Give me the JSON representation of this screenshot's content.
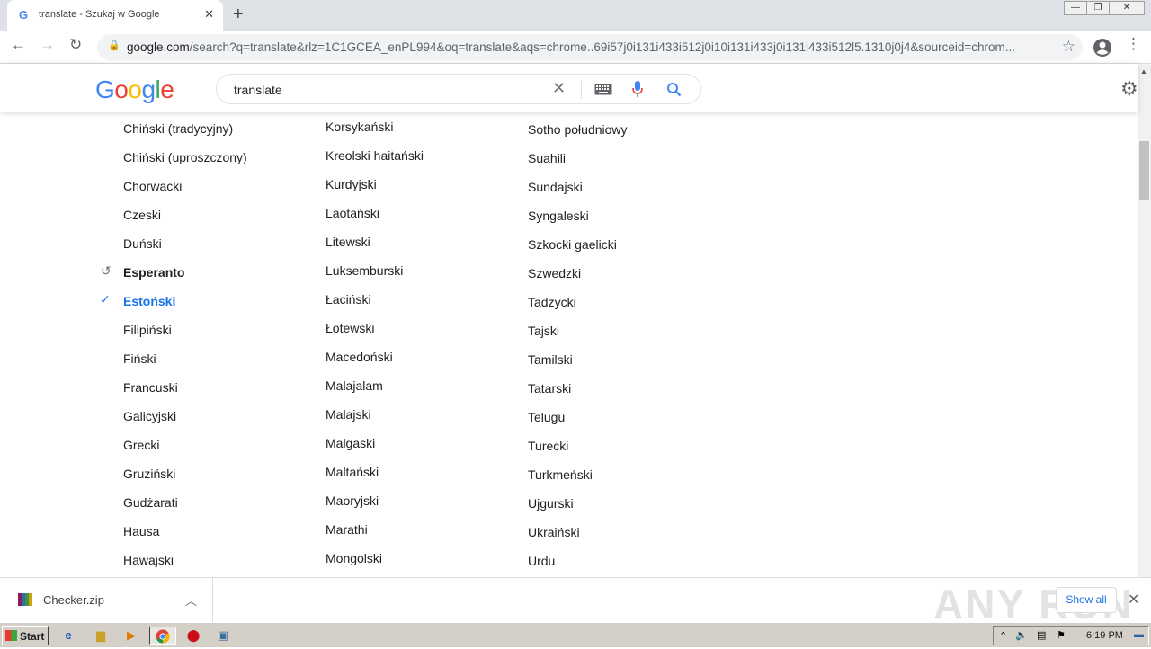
{
  "browser": {
    "tab_title": "translate - Szukaj w Google",
    "tab_favicon": "G",
    "url_domain": "google.com",
    "url_rest": "/search?q=translate&rlz=1C1GCEA_enPL994&oq=translate&aqs=chrome..69i57j0i131i433i512j0i10i131i433j0i131i433i512l5.1310j0j4&sourceid=chrom..."
  },
  "google": {
    "logo": "Google",
    "query": "translate"
  },
  "languages": {
    "col1": [
      "Chiński (tradycyjny)",
      "Chiński (uproszczony)",
      "Chorwacki",
      "Czeski",
      "Duński",
      "Esperanto",
      "Estoński",
      "Filipiński",
      "Fiński",
      "Francuski",
      "Galicyjski",
      "Grecki",
      "Gruziński",
      "Gudżarati",
      "Hausa",
      "Hawajski"
    ],
    "col2": [
      "Korsykański",
      "Kreolski haitański",
      "Kurdyjski",
      "Laotański",
      "Litewski",
      "Luksemburski",
      "Łaciński",
      "Łotewski",
      "Macedoński",
      "Malajalam",
      "Malajski",
      "Malgaski",
      "Maltański",
      "Maoryjski",
      "Marathi",
      "Mongolski"
    ],
    "col3": [
      "Sotho południowy",
      "Suahili",
      "Sundajski",
      "Syngaleski",
      "Szkocki gaelicki",
      "Szwedzki",
      "Tadżycki",
      "Tajski",
      "Tamilski",
      "Tatarski",
      "Telugu",
      "Turecki",
      "Turkmeński",
      "Ujgurski",
      "Ukraiński",
      "Urdu"
    ],
    "recent_marker": "history-icon",
    "selected_marker": "check-icon"
  },
  "download": {
    "filename": "Checker.zip",
    "show_all": "Show all"
  },
  "watermark": "ANY RUN",
  "taskbar": {
    "start": "Start",
    "time": "6:19 PM"
  },
  "colors": {
    "selected": "#1a73e8",
    "google_blue": "#4285f4",
    "google_red": "#ea4335",
    "google_yellow": "#fbbc05",
    "google_green": "#34a853"
  }
}
